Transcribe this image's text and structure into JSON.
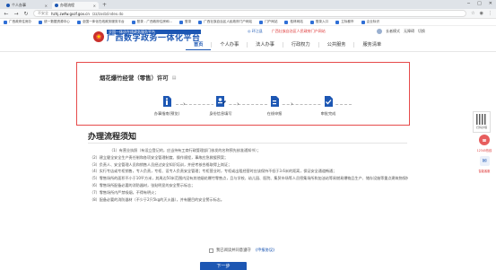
{
  "browser": {
    "tabs": [
      {
        "label": "个人办事",
        "active": false
      },
      {
        "label": "办理流程",
        "active": true
      }
    ],
    "new_tab": "+",
    "window_controls": [
      "─",
      "□",
      "✕"
    ],
    "nav": {
      "back": "←",
      "forward": "→",
      "reload": "↻"
    },
    "url": {
      "security": "不安全",
      "domain": "hzhj.zwfw.gxzf.gov.cn",
      "path": "/zz/zxsb/index.do"
    },
    "bookmarks": [
      "广西政府住房办",
      "统一数据资源中心",
      "全国一体化在线政务服务平台",
      "登录 - 广西政府住房和...",
      "登录",
      "广西壮族自治区人民政府门户网站",
      "门户网站",
      "桂林网站",
      "登录入口",
      "立标都市",
      "企业标识"
    ]
  },
  "site": {
    "logo_top": "全国一体化在线政务服务平台",
    "logo_main": "广西数字政务一体化平台",
    "top_links": {
      "location": "◎ 环江县",
      "user_area": "广西壮族自治区人民政府门户网站"
    },
    "top_right": [
      "长者模式",
      "无障碍",
      "切换"
    ],
    "nav": [
      "首页",
      "个人办事",
      "法人办事",
      "行政权力",
      "公共服务",
      "服务清单"
    ],
    "nav_active": 0
  },
  "service": {
    "title": "烟花爆竹经营（零售）许可",
    "steps": [
      {
        "icon": "info-icon",
        "label": "办事指南(预览)"
      },
      {
        "icon": "user-edit-icon",
        "label": "身份信息填写"
      },
      {
        "icon": "upload-icon",
        "label": "在线申报"
      },
      {
        "icon": "check-icon",
        "label": "审批完成"
      }
    ]
  },
  "process": {
    "title": "办理流程须知",
    "items": [
      "（1）有营业执照（有设立登记的，应当持有工商行政管理部门核发的名称预先核准通知书）；",
      "（2）建立健全安全生产责任制和各项安全管理制度、操作规程，事故应急救援预案；",
      "（3）负责人、安全管理人员和销售人员经过安全知识培训，并经考核合格取得上岗证；",
      "（4）实行专店或专柜销售，专人负责，专柜、设专人负责安全管理；专柜营业时，专柜或出租经营时应该保持不低于3.6米的距离，保证安全通道畅通；",
      "（5）零售场所的面积不小于10平方米，其周边50米范围内没有其他烟花爆竹零售点，且与学校、幼儿园、医院、集贸市场等人员密集场所和加油站等易燃易爆物品生产、储存设施等重点建筑物保持100米以上的安全距离；",
      "（6）零售场所配备必要的消防器材，张贴明显的安全警示标志；",
      "（7）零售场所内严禁吸烟，不得有明火；",
      "（8）配备必要的消防器材（不少于2只5kg的灭火器），并有醒目的安全警示标志。"
    ]
  },
  "agreement": {
    "label": "我已阅读并同意遵守",
    "link": "《申报协议》"
  },
  "next_button": "下一步",
  "floating": {
    "qr_label": "扫码办理",
    "hotline_label": "12345热线",
    "help_label": "智能客服"
  },
  "colors": {
    "primary": "#1d57b3",
    "highlight": "#e64a4a"
  }
}
